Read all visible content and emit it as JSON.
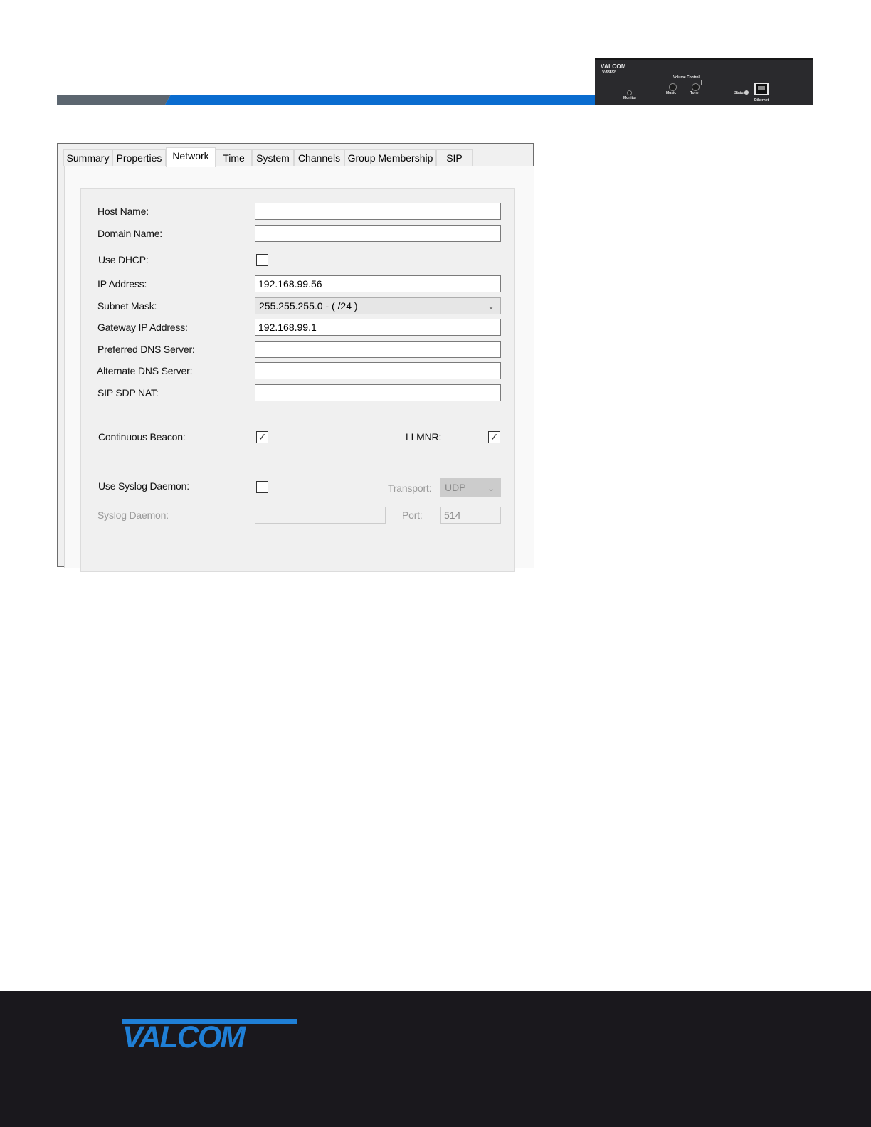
{
  "device": {
    "brand": "VALCOM",
    "model": "V-9972",
    "labels": {
      "volume_control": "Volume Control",
      "music": "Music",
      "tone": "Tone",
      "monitor": "Monitor",
      "status": "Status",
      "ethernet": "Ethernet"
    }
  },
  "tabs": [
    {
      "label": "Summary",
      "active": false
    },
    {
      "label": "Properties",
      "active": false
    },
    {
      "label": "Network",
      "active": true
    },
    {
      "label": "Time",
      "active": false
    },
    {
      "label": "System",
      "active": false
    },
    {
      "label": "Channels",
      "active": false
    },
    {
      "label": "Group Membership",
      "active": false
    },
    {
      "label": "SIP",
      "active": false
    }
  ],
  "network": {
    "host_name": {
      "label": "Host Name:",
      "value": ""
    },
    "domain_name": {
      "label": "Domain Name:",
      "value": ""
    },
    "use_dhcp": {
      "label": "Use DHCP:",
      "checked": false
    },
    "ip_address": {
      "label": "IP Address:",
      "value": "192.168.99.56"
    },
    "subnet_mask": {
      "label": "Subnet Mask:",
      "value": "255.255.255.0 - ( /24 )"
    },
    "gateway": {
      "label": "Gateway IP Address:",
      "value": "192.168.99.1"
    },
    "preferred_dns": {
      "label": "Preferred DNS Server:",
      "value": ""
    },
    "alternate_dns": {
      "label": "Alternate DNS Server:",
      "value": ""
    },
    "sip_sdp_nat": {
      "label": "SIP SDP NAT:",
      "value": ""
    },
    "continuous_beacon": {
      "label": "Continuous Beacon:",
      "checked": true
    },
    "llmnr": {
      "label": "LLMNR:",
      "checked": true
    },
    "use_syslog": {
      "label": "Use Syslog Daemon:",
      "checked": false
    },
    "transport": {
      "label": "Transport:",
      "value": "UDP",
      "enabled": false
    },
    "syslog_daemon": {
      "label": "Syslog Daemon:",
      "value": "",
      "enabled": false
    },
    "port": {
      "label": "Port:",
      "value": "514",
      "enabled": false
    }
  },
  "footer": {
    "logo_text": "VALCOM"
  },
  "colors": {
    "accent_blue": "#0a6ccf",
    "stripe_grey": "#5c6670",
    "footer_bg": "#1a181d",
    "logo_blue": "#1f7fd6"
  },
  "icons": {
    "check": "check-icon",
    "dropdown": "chevron-down-icon"
  }
}
